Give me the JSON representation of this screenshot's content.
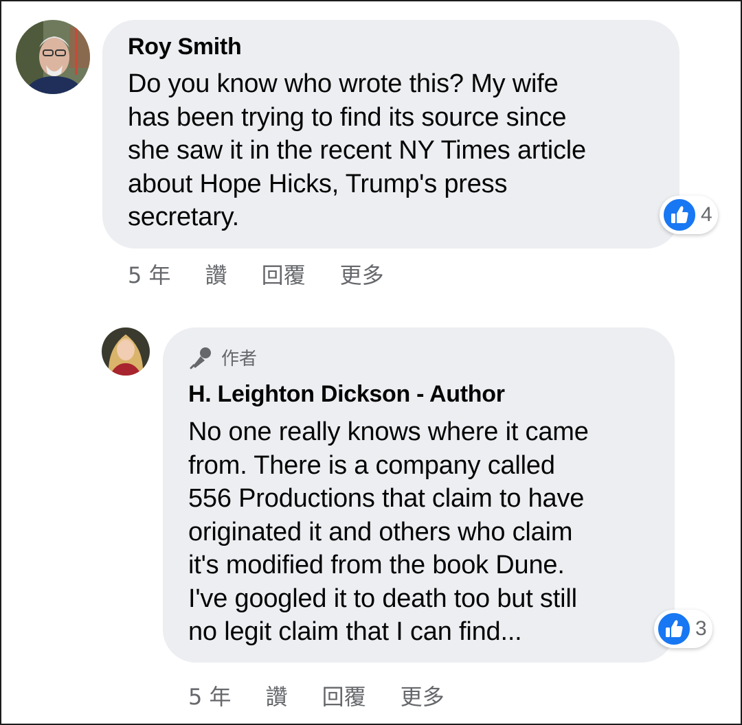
{
  "comments": [
    {
      "author": "Roy Smith",
      "text_lines": [
        "Do you know who wrote this? My wife",
        "has been trying to find its source since",
        "she saw it in the recent NY Times article",
        "about Hope Hicks, Trump's press",
        "secretary."
      ],
      "reaction": {
        "icon": "like-icon",
        "count": "4"
      },
      "actions": {
        "time": "5 年",
        "like": "讚",
        "reply": "回覆",
        "more": "更多"
      }
    },
    {
      "badge": "作者",
      "author": "H. Leighton Dickson - Author",
      "text_lines": [
        "No one really knows where it came",
        "from. There is a company called",
        "556 Productions that claim to have",
        "originated it and others who claim",
        "it's modified from the book Dune.",
        "I've googled it to death too but still",
        "no legit claim that I can find..."
      ],
      "reaction": {
        "icon": "like-icon",
        "count": "3"
      },
      "actions": {
        "time": "5 年",
        "like": "讚",
        "reply": "回覆",
        "more": "更多"
      }
    }
  ],
  "colors": {
    "bubble": "#eceef1",
    "secondary_text": "#65676b",
    "like_blue": "#1877f2"
  }
}
